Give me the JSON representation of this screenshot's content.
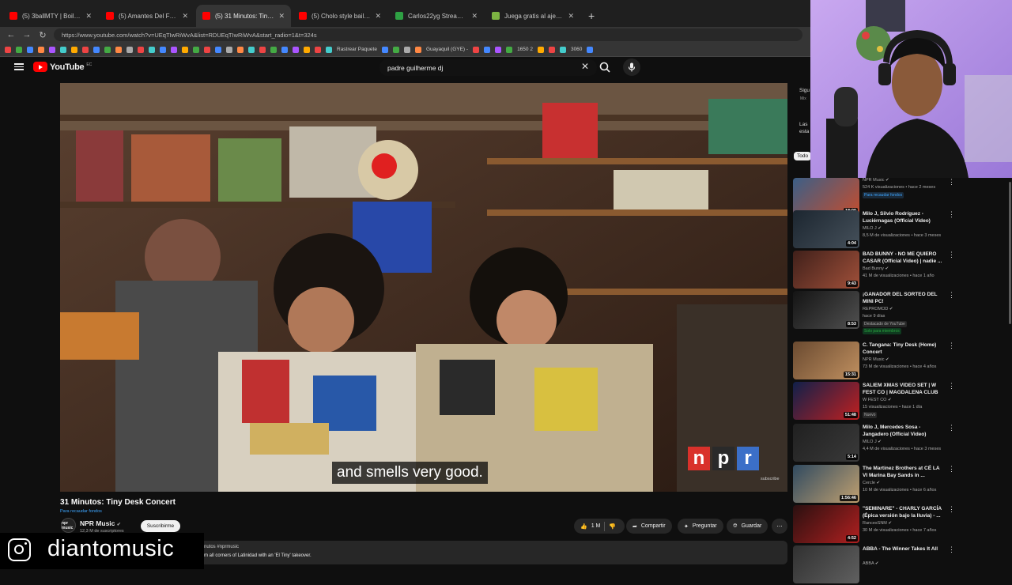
{
  "browser": {
    "tabs": [
      {
        "title": "(5) 3ballMTY | Boiler Room: SYSTE",
        "color": "#ff0000",
        "active": false
      },
      {
        "title": "(5) Amantes Del Futuro | Boiler Ro",
        "color": "#ff0000",
        "active": false
      },
      {
        "title": "(5) 31 Minutos: Tiny Desk Concert",
        "color": "#ff0000",
        "active": true
      },
      {
        "title": "(5) Cholo style bailando cumbia re",
        "color": "#ff0000",
        "active": false
      },
      {
        "title": "Carlos22yg Stream - Watch L",
        "color": "#2ea043",
        "active": false
      },
      {
        "title": "Juega gratis al ajedrez online con",
        "color": "#7cb342",
        "active": false
      }
    ],
    "url": "https://www.youtube.com/watch?v=UEqTIwRiWvA&list=RDUEqTIwRiWvA&start_radio=1&t=324s",
    "bookmark_labels": [
      "Rastrear Paquete",
      "Guayaquil (GYE) -",
      "1650 2",
      "3060"
    ]
  },
  "header": {
    "brand": "YouTube",
    "country": "EC",
    "search_query": "padre guilherme dj"
  },
  "video": {
    "caption": "and smells very good.",
    "watermark_letters": [
      "n",
      "p",
      "r"
    ],
    "subscribe_watermark": "subscribe",
    "title": "31 Minutos: Tiny Desk Concert",
    "pill": "Para recaudar fondos",
    "channel": "NPR Music",
    "channel_avatar": "npr music",
    "subs": "12,3 M de suscriptores",
    "subscribe_label": "Suscribirme",
    "like_count": "1 M",
    "share_label": "Compartir",
    "ask_label": "Preguntar",
    "save_label": "Guardar",
    "desc_line1": "nutos #nprmusic",
    "desc_line2": "m all corners of Latinidad with an 'El Tiny' takeover."
  },
  "overlay": {
    "instagram_handle": "diantomusic"
  },
  "sidebar": {
    "partial_texts": [
      "Sigu",
      "Mix",
      "Las",
      "esta",
      "Todo"
    ],
    "recommendations": [
      {
        "title": "",
        "channel": "NPR Music",
        "views": "524 K visualizaciones • hace 2 meses",
        "badge": "Para recaudar fondos",
        "duration": "18:00",
        "thumb": [
          "#3b5f87",
          "#c44d2e"
        ]
      },
      {
        "title": "Milo J, Silvio Rodríguez - Luciérnagas (Official Video)",
        "channel": "MILO J",
        "views": "8,5 M de visualizaciones • hace 3 meses",
        "badge": "",
        "duration": "4:04",
        "thumb": [
          "#1c2630",
          "#45505a"
        ]
      },
      {
        "title": "BAD BUNNY - NO ME QUIERO CASAR (Official Video) | nadie ...",
        "channel": "Bad Bunny",
        "views": "41 M de visualizaciones • hace 1 año",
        "badge": "",
        "duration": "9:43",
        "thumb": [
          "#40201a",
          "#a0503a"
        ]
      },
      {
        "title": "¡GANADOR DEL SORTEO DEL MINI PC!",
        "channel": "REPROMOD",
        "views": "hace 9 días",
        "badge": "Destacado de YouTube",
        "extra": "Solo para miembros",
        "duration": "8:53",
        "thumb": [
          "#141414",
          "#505050"
        ]
      },
      {
        "title": "C. Tangana: Tiny Desk (Home) Concert",
        "channel": "NPR Music",
        "views": "73 M de visualizaciones • hace 4 años",
        "badge": "",
        "duration": "15:31",
        "thumb": [
          "#6a4a30",
          "#c09060"
        ]
      },
      {
        "title": "SALIEM XMAS VIDEO SET | W FEST CO | MAGDALENA CLUB",
        "channel": "W FEST CO",
        "views": "15 visualizaciones • hace 1 día",
        "badge": "Nuevo",
        "duration": "51:48",
        "thumb": [
          "#10204a",
          "#c02020"
        ]
      },
      {
        "title": "Milo J, Mercedes Sosa - Jangadero (Official Video)",
        "channel": "MILO J",
        "views": "4,4 M de visualizaciones • hace 3 meses",
        "badge": "",
        "duration": "5:14",
        "thumb": [
          "#202020",
          "#3a3a3a"
        ]
      },
      {
        "title": "The Martinez Brothers at CÉ LA VI Marina Bay Sands in ...",
        "channel": "Cercle",
        "views": "10 M de visualizaciones • hace 6 años",
        "badge": "",
        "duration": "1:56:46",
        "thumb": [
          "#304a60",
          "#c0a070"
        ]
      },
      {
        "title": "\"SEMINARE\" - CHARLY GARCÍA (Épica versión bajo la lluvia) - ...",
        "channel": "RancesSNM",
        "views": "30 M de visualizaciones • hace 7 años",
        "badge": "",
        "duration": "4:52",
        "thumb": [
          "#2a1010",
          "#b02020"
        ]
      },
      {
        "title": "ABBA - The Winner Takes It All",
        "channel": "ABBA",
        "views": "",
        "badge": "",
        "duration": "",
        "thumb": [
          "#303030",
          "#606060"
        ]
      }
    ]
  }
}
